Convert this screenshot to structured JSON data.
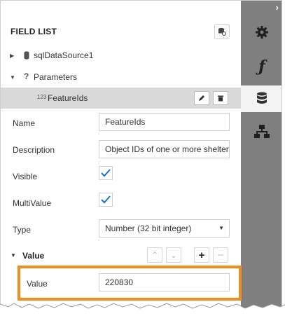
{
  "panel": {
    "title": "FIELD LIST"
  },
  "tree": {
    "items": [
      {
        "label": "sqlDataSource1"
      },
      {
        "label": "Parameters"
      },
      {
        "label": "FeatureIds",
        "type_badge": "123"
      }
    ]
  },
  "form": {
    "name_label": "Name",
    "name_value": "FeatureIds",
    "description_label": "Description",
    "description_value": "Object IDs of one or more shelters",
    "visible_label": "Visible",
    "visible_checked": true,
    "multivalue_label": "MultiValue",
    "multivalue_checked": true,
    "type_label": "Type",
    "type_value": "Number (32 bit integer)",
    "value_section_label": "Value",
    "value_label": "Value",
    "value_value": "220830"
  },
  "tabs": [
    {
      "icon": "gear-icon"
    },
    {
      "icon": "function-icon"
    },
    {
      "icon": "database-icon",
      "active": true
    },
    {
      "icon": "hierarchy-icon"
    }
  ],
  "colors": {
    "accent_highlight": "#f28c1e",
    "check": "#1a73c8",
    "tabstrip": "#7f7f7f"
  }
}
